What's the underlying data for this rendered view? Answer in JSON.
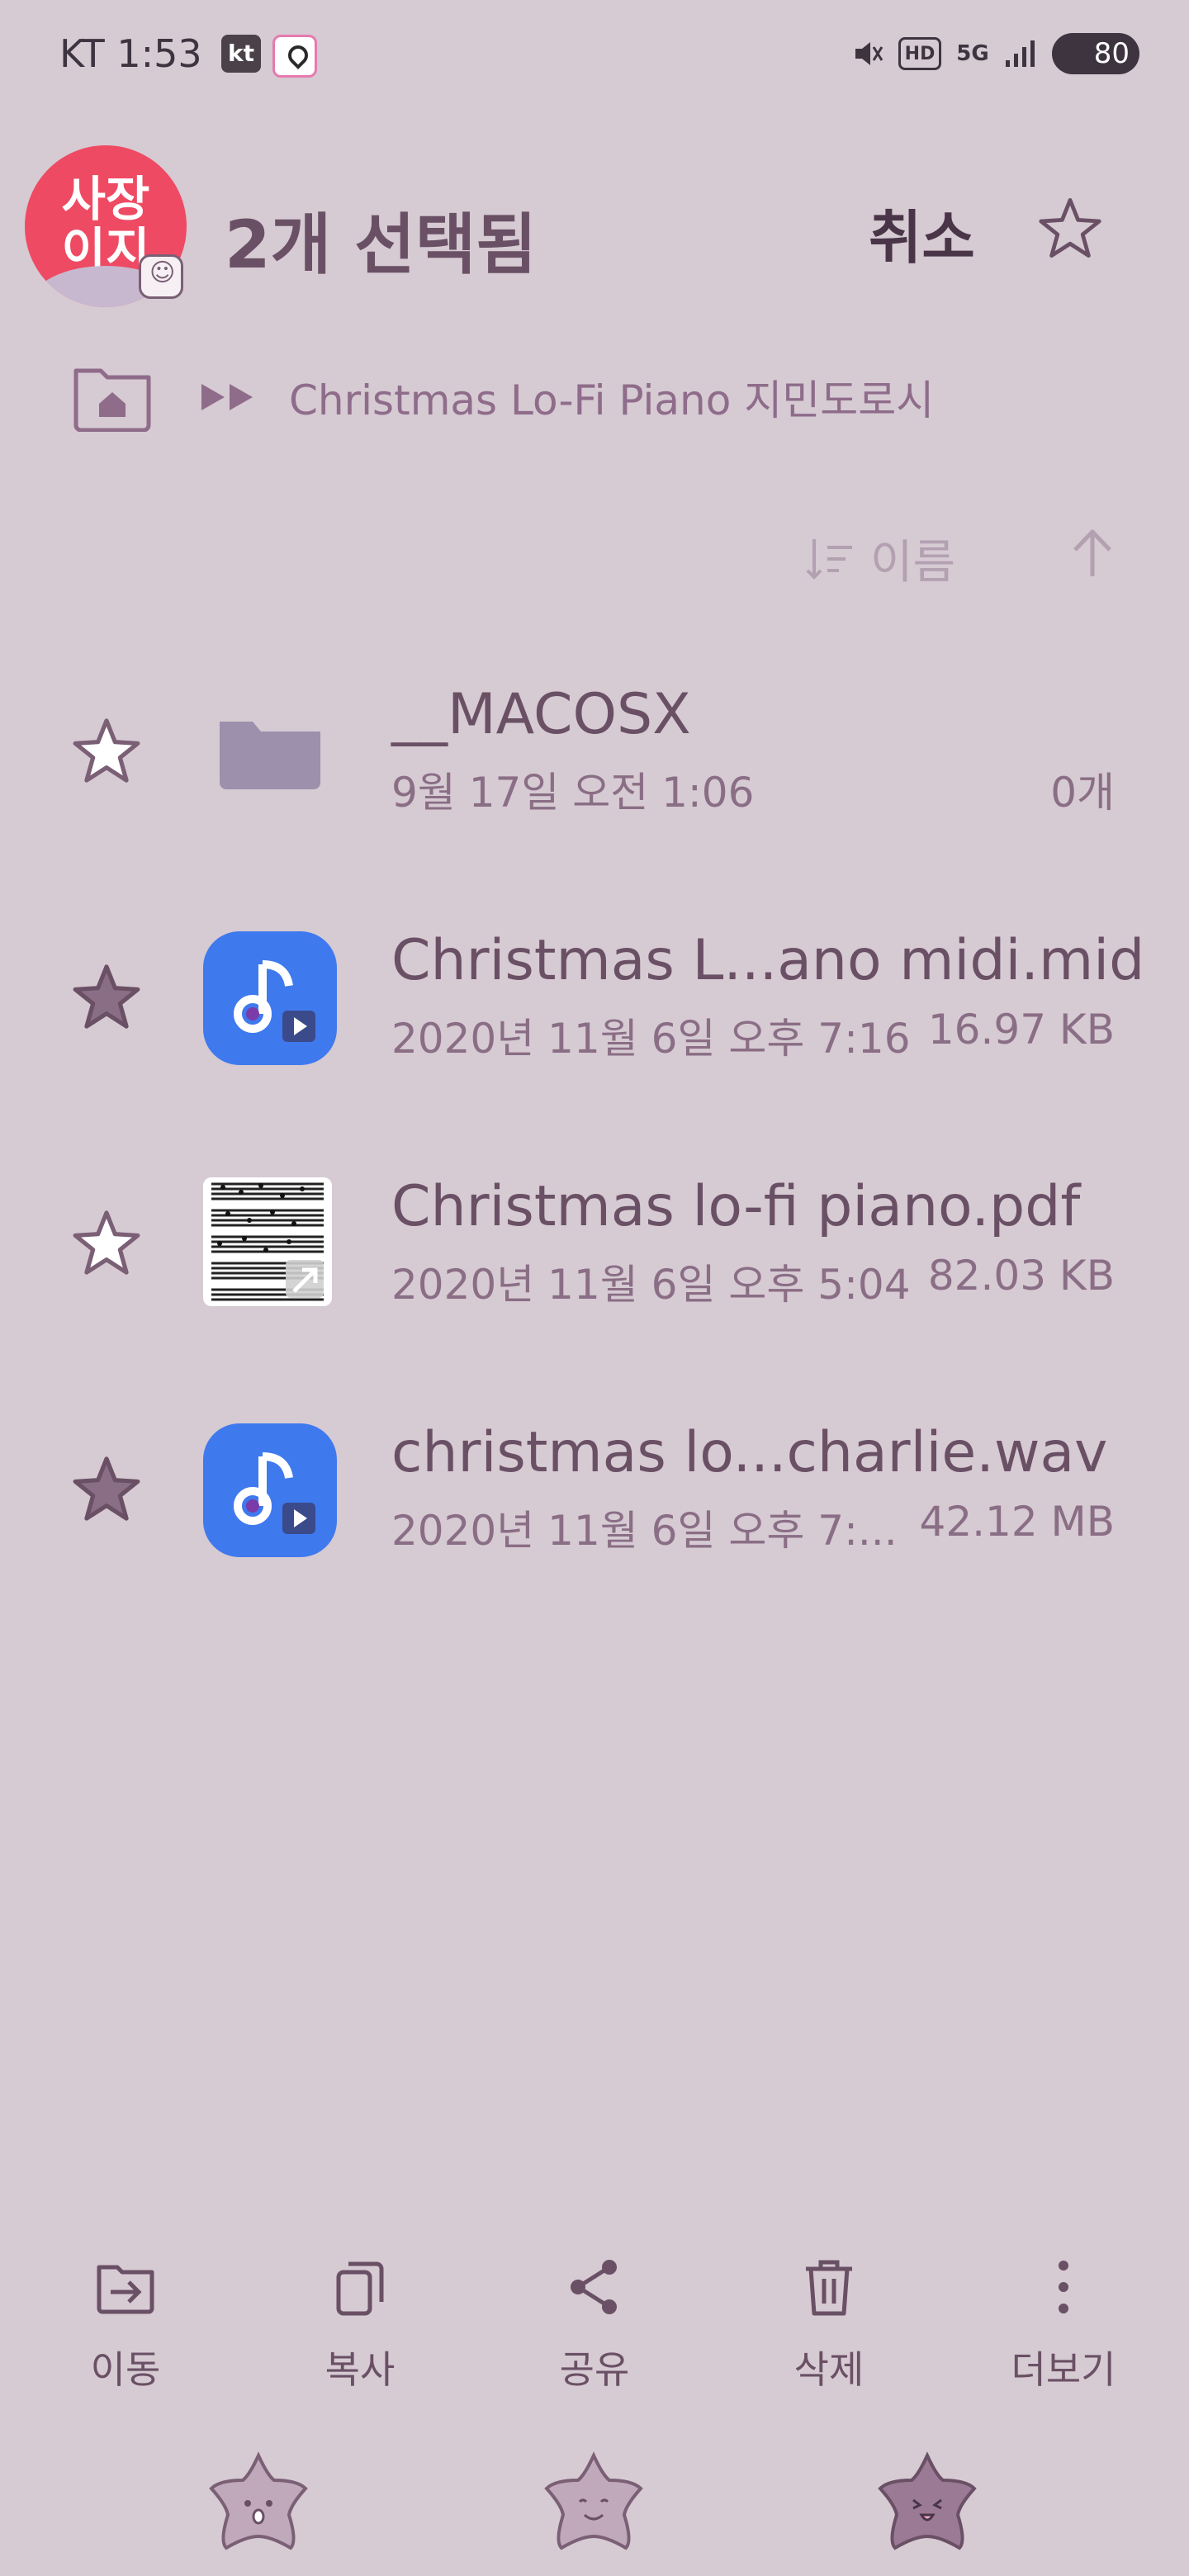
{
  "status_bar": {
    "carrier": "KT",
    "time": "1:53",
    "app_badge": "kt",
    "network": "5G",
    "hd": "HD",
    "battery": "80",
    "icons": [
      "mute-icon",
      "hd-voice-icon",
      "5g-icon",
      "signal-icon",
      "battery-icon"
    ]
  },
  "header": {
    "avatar_text": "사장\n이지",
    "selection_title": "2개 선택됨",
    "cancel_label": "취소",
    "favorite_icon": "star-outline-icon"
  },
  "breadcrumb": {
    "path_text": "Christmas Lo-Fi Piano 지민도로시"
  },
  "sort": {
    "label": "이름",
    "direction": "ascending"
  },
  "files": [
    {
      "name": "__MACOSX",
      "meta": "9월 17일 오전 1:06",
      "size": "0개",
      "type": "folder",
      "favorite": false
    },
    {
      "name": "Christmas L...ano midi.mid",
      "meta": "2020년 11월 6일 오후 7:16",
      "size": "16.97 KB",
      "type": "audio",
      "favorite": true
    },
    {
      "name": "Christmas lo-fi piano.pdf",
      "meta": "2020년 11월 6일 오후 5:04",
      "size": "82.03 KB",
      "type": "pdf",
      "favorite": false
    },
    {
      "name": "christmas lo...charlie.wav",
      "meta": "2020년 11월 6일 오후 7:...",
      "size": "42.12 MB",
      "type": "audio",
      "favorite": true
    }
  ],
  "bottom_actions": [
    {
      "label": "이동",
      "icon": "move-icon"
    },
    {
      "label": "복사",
      "icon": "copy-icon"
    },
    {
      "label": "공유",
      "icon": "share-icon"
    },
    {
      "label": "삭제",
      "icon": "trash-icon"
    },
    {
      "label": "더보기",
      "icon": "more-icon"
    }
  ],
  "colors": {
    "background": "#d6cad3",
    "text_primary": "#6a5065",
    "avatar_red": "#ef4a63",
    "music_blue": "#3f79ee"
  }
}
